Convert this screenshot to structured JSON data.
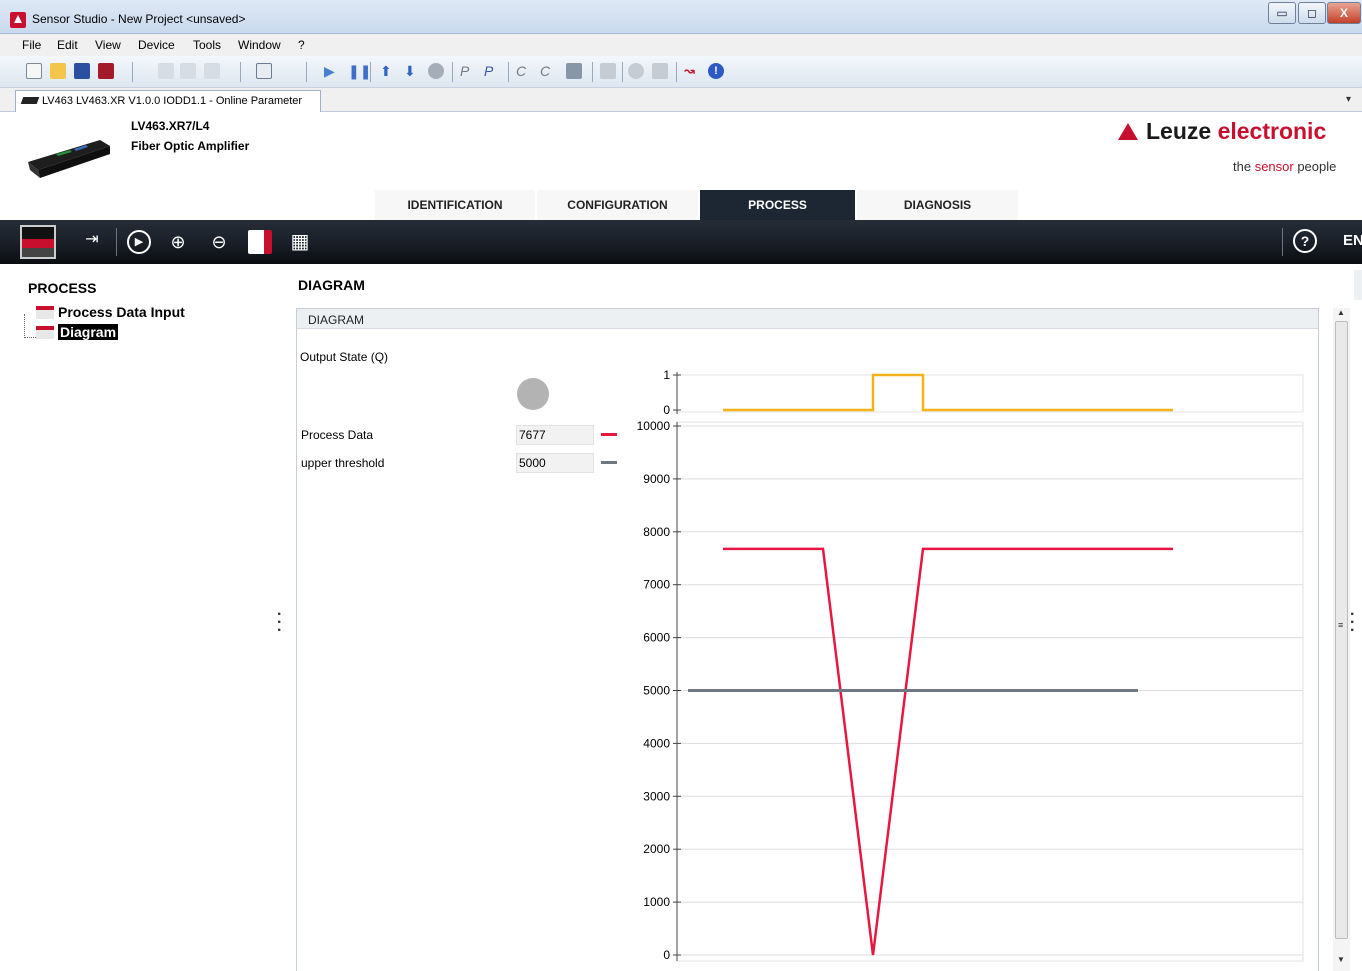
{
  "window": {
    "title": "Sensor Studio - New Project  <unsaved>",
    "minimize": "▭",
    "maximize": "◻",
    "close": "X"
  },
  "menu": [
    "File",
    "Edit",
    "View",
    "Device",
    "Tools",
    "Window",
    "?"
  ],
  "document_tab": {
    "label": "LV463 LV463.XR V1.0.0 IODD1.1 - Online Parameter",
    "dropdown": "▾"
  },
  "device": {
    "name": "LV463.XR7/L4",
    "type": "Fiber Optic Amplifier"
  },
  "brand": {
    "logo_part1": "Leuze ",
    "logo_part2": "electronic",
    "slogan_part1": "the ",
    "slogan_part2": "sensor",
    "slogan_part3": " people",
    "brand_color": "#c8102e"
  },
  "main_tabs": [
    {
      "label": "IDENTIFICATION",
      "active": false
    },
    {
      "label": "CONFIGURATION",
      "active": false
    },
    {
      "label": "PROCESS",
      "active": true
    },
    {
      "label": "DIAGNOSIS",
      "active": false
    }
  ],
  "process_toolbar": {
    "icons": [
      "monitor-icon",
      "record-icon",
      "play-icon",
      "zoom-in-icon",
      "zoom-out-icon",
      "save-icon",
      "grid-icon"
    ],
    "help": "?",
    "language": "EN"
  },
  "nav": {
    "title": "PROCESS",
    "items": [
      {
        "label": "Process Data Input",
        "selected": false
      },
      {
        "label": "Diagram",
        "selected": true
      }
    ]
  },
  "content": {
    "title": "DIAGRAM",
    "panel_title": "DIAGRAM",
    "output_label": "Output State (Q)",
    "output_state_color": "#b3b3b3",
    "fields": [
      {
        "label": "Process Data",
        "value": "7677",
        "color": "#e8173f"
      },
      {
        "label": "upper threshold",
        "value": "5000",
        "color": "#6f7880"
      }
    ]
  },
  "chart_data": [
    {
      "type": "line",
      "ylim": [
        0,
        1
      ],
      "y_ticks": [
        0,
        1
      ],
      "x": [
        0,
        1,
        2,
        3,
        4,
        5,
        6,
        7,
        8,
        9
      ],
      "series": [
        {
          "values": [
            0,
            0,
            0,
            1,
            0,
            0,
            0,
            0,
            0
          ],
          "color": "#f5b31a",
          "step": true
        }
      ]
    },
    {
      "type": "line",
      "ylim": [
        0,
        10000
      ],
      "y_ticks": [
        0,
        1000,
        2000,
        3000,
        4000,
        5000,
        6000,
        7000,
        8000,
        9000,
        10000
      ],
      "grid": true,
      "series": [
        {
          "name": "Process Data",
          "x": [
            0,
            1,
            2,
            3,
            4,
            5,
            6,
            7,
            8,
            9
          ],
          "values": [
            7677,
            7677,
            7677,
            0,
            7677,
            7677,
            7677,
            7677,
            7677,
            7677
          ],
          "color": "#e8173f"
        },
        {
          "name": "upper threshold",
          "x": [
            -0.7,
            8.3
          ],
          "values": [
            5000,
            5000
          ],
          "color": "#6f7880"
        }
      ]
    }
  ]
}
